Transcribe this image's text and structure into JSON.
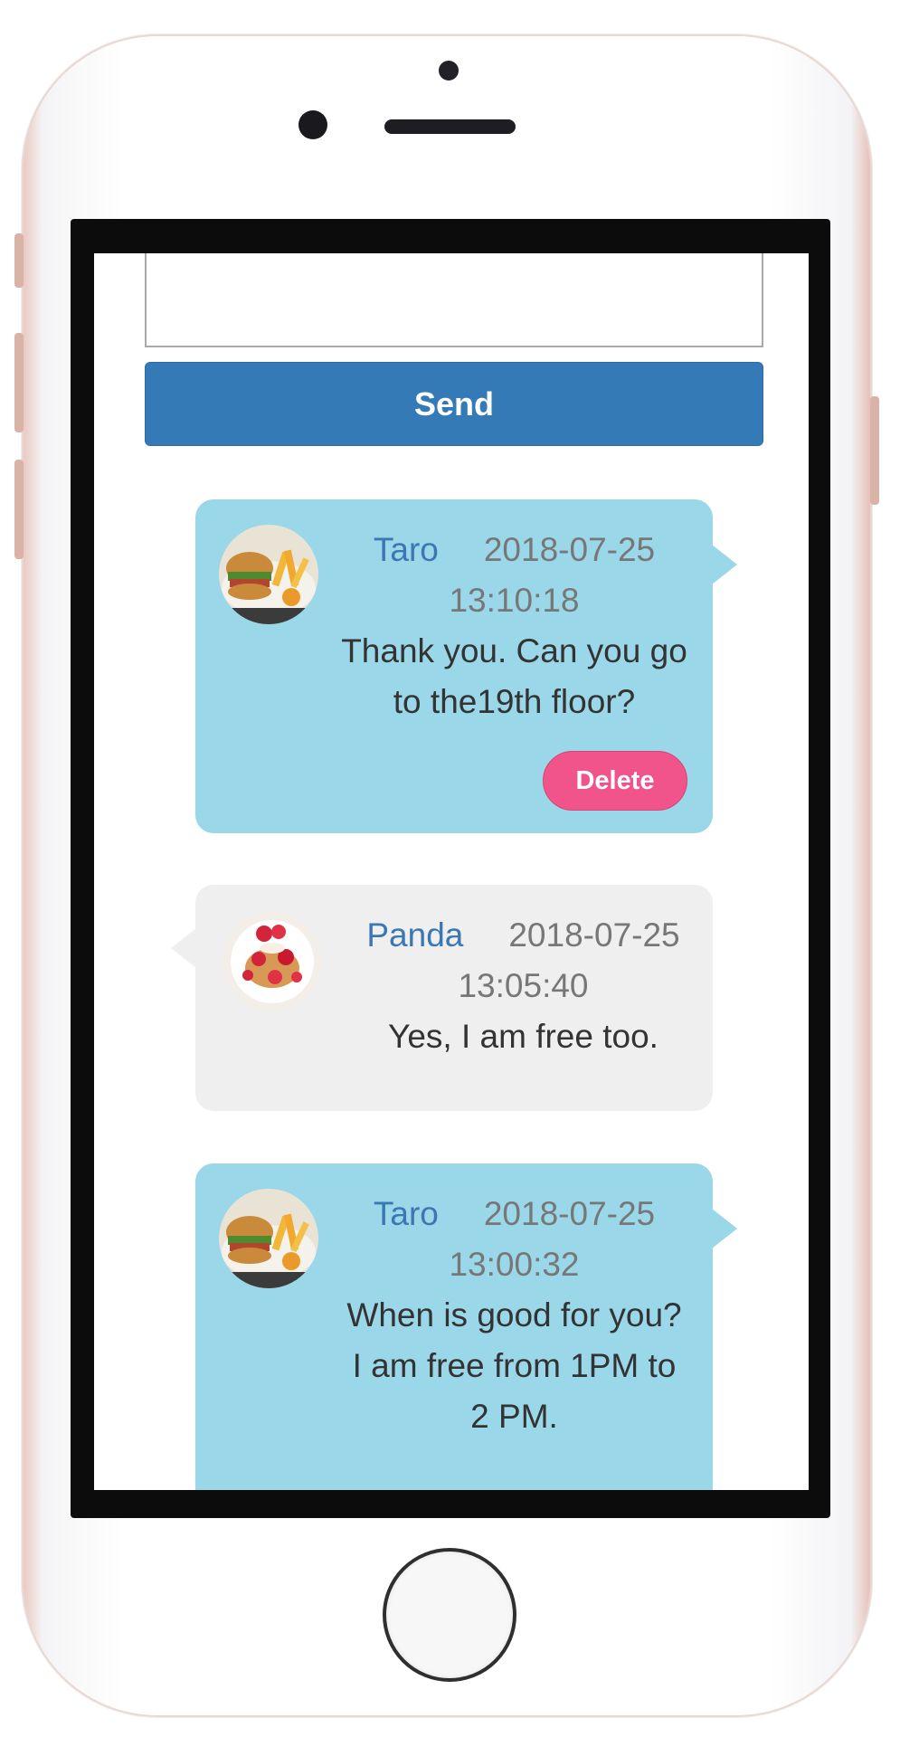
{
  "composer": {
    "input_value": "",
    "send_label": "Send"
  },
  "messages": [
    {
      "sender": "Taro",
      "date": "2018-07-25",
      "time": "13:10:18",
      "text": "Thank you. Can you go to the19th floor?",
      "own": true,
      "delete_label": "Delete",
      "avatar_icon": "burger-plate-avatar"
    },
    {
      "sender": "Panda",
      "date": "2018-07-25",
      "time": "13:05:40",
      "text": "Yes, I am free too.",
      "own": false,
      "avatar_icon": "strawberry-dessert-avatar"
    },
    {
      "sender": "Taro",
      "date": "2018-07-25",
      "time": "13:00:32",
      "text": "When is good for you?\nI am free from 1PM to 2 PM.",
      "own": true,
      "avatar_icon": "burger-plate-avatar"
    }
  ],
  "colors": {
    "own_bubble": "#9ad7e8",
    "other_bubble": "#efefef",
    "send_button": "#337ab7",
    "delete_button": "#f0548a",
    "sender_name": "#3a77b3"
  }
}
